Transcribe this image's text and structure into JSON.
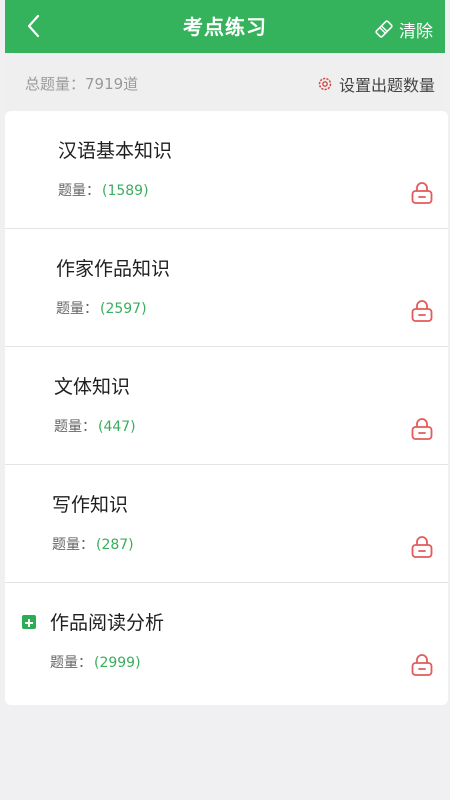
{
  "header": {
    "title": "考点练习",
    "clear_label": "清除",
    "back_icon": "chevron-left-icon",
    "clear_icon": "eraser-icon",
    "color": "#35b35c"
  },
  "summary": {
    "total": "总题量：7919道",
    "set_count_label": "设置出题数量",
    "settings_icon": "gear-icon"
  },
  "items": [
    {
      "title": "汉语基本知识",
      "count_prefix": "题量：",
      "count": "(1589)",
      "locked": true
    },
    {
      "title": "作家作品知识",
      "count_prefix": "题量：",
      "count": "(2597)",
      "locked": true
    },
    {
      "title": "文体知识",
      "count_prefix": "题量：",
      "count": "(447)",
      "locked": true
    },
    {
      "title": "写作知识",
      "count_prefix": "题量：",
      "count": "(287)",
      "locked": true
    },
    {
      "title": "作品阅读分析",
      "count_prefix": "题量：",
      "count": "(2999)",
      "locked": true,
      "expandable": true
    }
  ],
  "colors": {
    "accent": "#35b35c",
    "count": "#3aae5d",
    "lock": "#e45a5a"
  }
}
